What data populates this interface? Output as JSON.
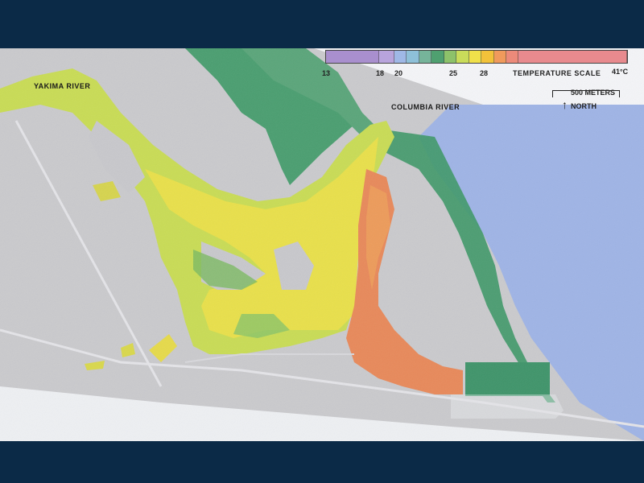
{
  "map": {
    "rivers": {
      "yakima": "YAKIMA RIVER",
      "columbia": "COLUMBIA RIVER"
    },
    "legend": {
      "title": "TEMPERATURE SCALE",
      "unit": "41°C",
      "ticks": [
        "13",
        "18",
        "20",
        "25",
        "28"
      ],
      "colors": [
        "#a98fce",
        "#b8a4dc",
        "#9fb8e6",
        "#8ec0d8",
        "#76b49a",
        "#4fa070",
        "#8dc26a",
        "#c9dc5a",
        "#f0e04a",
        "#f2c23a",
        "#f09a5c",
        "#ec8a7a",
        "#e88a8e"
      ]
    },
    "scale": {
      "distance": "500 METERS",
      "north": "NORTH",
      "north_arrow": "↑"
    },
    "colors": {
      "background": "#0b2a47",
      "land": "#c8c8cc",
      "columbia_water": "#9db3e6",
      "cool_green": "#3f9a6a",
      "warm_yellow": "#e6df4a",
      "hot_orange": "#e98b5c"
    }
  }
}
